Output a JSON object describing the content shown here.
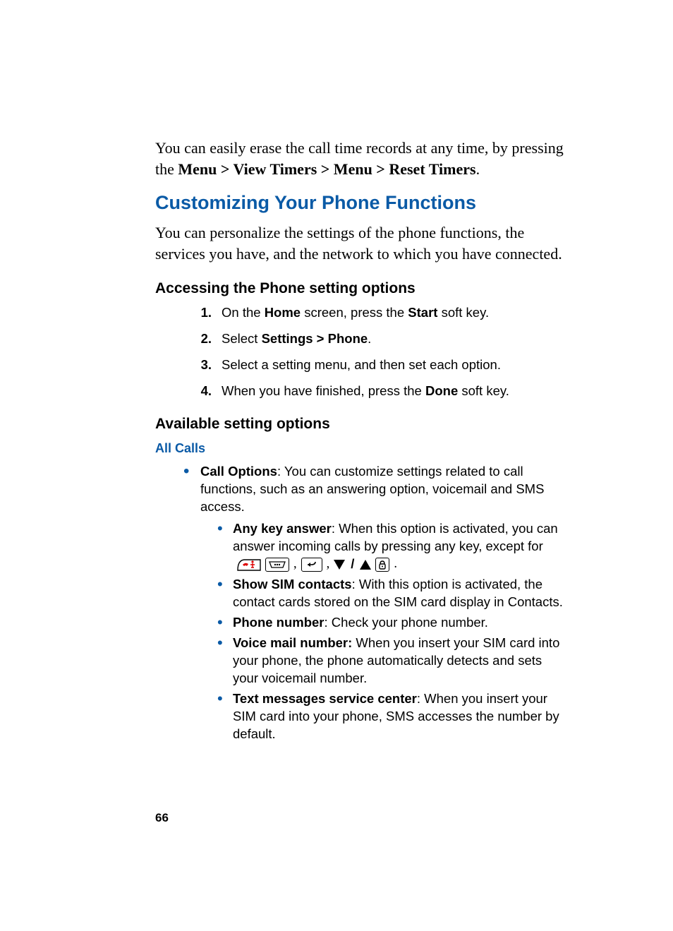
{
  "intro": {
    "pre": "You can easily erase the call time records at any time, by pressing the ",
    "bold": "Menu > View Timers > Menu > Reset Timers",
    "post": "."
  },
  "section_title": "Customizing Your Phone Functions",
  "section_intro": "You can personalize the settings of the phone functions, the services you have, and the network to which you have connected.",
  "access_title": "Accessing the Phone setting options",
  "steps": [
    {
      "num": "1.",
      "pre": "On the ",
      "b1": "Home",
      "mid": " screen, press the ",
      "b2": "Start",
      "post": " soft key."
    },
    {
      "num": "2.",
      "pre": "Select ",
      "b1": "Settings > Phone",
      "mid": "",
      "b2": "",
      "post": "."
    },
    {
      "num": "3.",
      "pre": "Select a setting menu, and then set each option.",
      "b1": "",
      "mid": "",
      "b2": "",
      "post": ""
    },
    {
      "num": "4.",
      "pre": "When you have finished, press the ",
      "b1": "Done",
      "mid": "",
      "b2": "",
      "post": " soft key."
    }
  ],
  "avail_title": "Available setting options",
  "all_calls_title": "All Calls",
  "call_options": {
    "label": "Call Options",
    "text": ": You can customize settings related to call functions, such as an answering option, voicemail and SMS access."
  },
  "sub_bullets": [
    {
      "label": "Any key answer",
      "text": ": When this option is activated, you can answer incoming calls by pressing any key, except for",
      "has_icons": true
    },
    {
      "label": "Show SIM contacts",
      "text": ": With this option is activated, the contact cards stored on the SIM card display in Contacts.",
      "has_icons": false
    },
    {
      "label": "Phone number",
      "text": ": Check your phone number.",
      "has_icons": false
    },
    {
      "label": "Voice mail number:",
      "text": " When you insert your SIM card into your phone, the phone automatically detects and sets your voicemail number.",
      "has_icons": false
    },
    {
      "label": "Text messages service center",
      "text": ": When you insert your SIM card into your phone, SMS accesses the number by default.",
      "has_icons": false
    }
  ],
  "icons": {
    "end_key": "end-call-key-icon",
    "softkey_left": "softkey-dots-icon",
    "back_key": "back-key-icon",
    "nav_down": "nav-down-icon",
    "nav_up": "nav-up-icon",
    "power_key": "power-lock-key-icon"
  },
  "page_number": "66"
}
